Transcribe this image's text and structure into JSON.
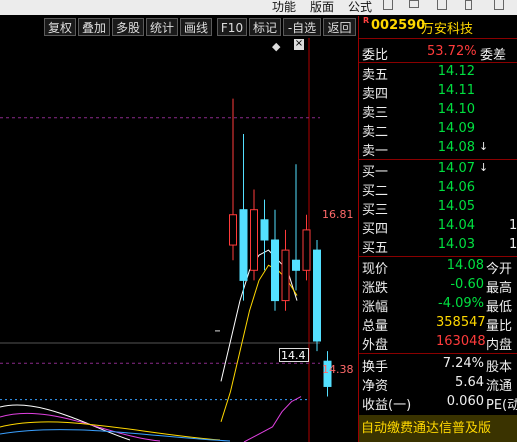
{
  "menu": {
    "items": [
      "功能",
      "版面",
      "公式"
    ]
  },
  "toolbar": {
    "buttons": [
      "复权",
      "叠加",
      "多股",
      "统计",
      "画线",
      "F10",
      "标记",
      "-自选",
      "返回"
    ]
  },
  "chart": {
    "price_labels": {
      "high": "16.81",
      "low": "14.38",
      "current": "14.4"
    },
    "close_icon": "×",
    "diamond_icon": "◆"
  },
  "chart_data": {
    "type": "candlestick",
    "title": "",
    "xlabel": "",
    "ylabel": "",
    "ylim": [
      13.6,
      17.6
    ],
    "reference_lines": [
      16.81,
      14.38
    ],
    "candles": [
      {
        "o": 15.55,
        "c": 15.85,
        "h": 17.0,
        "l": 15.4
      },
      {
        "o": 15.9,
        "c": 15.2,
        "h": 16.65,
        "l": 15.0
      },
      {
        "o": 15.3,
        "c": 15.9,
        "h": 16.1,
        "l": 15.2
      },
      {
        "o": 15.8,
        "c": 15.6,
        "h": 16.0,
        "l": 15.3
      },
      {
        "o": 15.6,
        "c": 15.0,
        "h": 15.9,
        "l": 14.9
      },
      {
        "o": 15.0,
        "c": 15.5,
        "h": 15.7,
        "l": 14.9
      },
      {
        "o": 15.4,
        "c": 15.3,
        "h": 16.35,
        "l": 15.1
      },
      {
        "o": 15.3,
        "c": 15.7,
        "h": 15.85,
        "l": 15.2
      },
      {
        "o": 15.5,
        "c": 14.6,
        "h": 15.6,
        "l": 14.5
      },
      {
        "o": 14.4,
        "c": 14.15,
        "h": 14.5,
        "l": 14.05
      }
    ],
    "ma_lines": [
      {
        "color": "#ffffff",
        "values": [
          14.2,
          14.6,
          15.0,
          15.3,
          15.45,
          15.5,
          15.4,
          15.3,
          15.0
        ]
      },
      {
        "color": "#ffd800",
        "values": [
          13.8,
          14.1,
          14.5,
          14.9,
          15.2,
          15.35,
          15.3,
          15.2,
          15.05
        ]
      },
      {
        "color": "#e040e0",
        "values": [
          13.6,
          13.65,
          13.7,
          13.75,
          13.9,
          14.0,
          14.05
        ]
      }
    ]
  },
  "stock": {
    "flag": "R",
    "code": "002590",
    "name": "万安科技"
  },
  "ratio": {
    "label": "委比",
    "value": "53.72%",
    "label2": "委差"
  },
  "asks": [
    {
      "label": "卖五",
      "price": "14.12"
    },
    {
      "label": "卖四",
      "price": "14.11"
    },
    {
      "label": "卖三",
      "price": "14.10"
    },
    {
      "label": "卖二",
      "price": "14.09"
    },
    {
      "label": "卖一",
      "price": "14.08",
      "arrow": "↓"
    }
  ],
  "bids": [
    {
      "label": "买一",
      "price": "14.07",
      "arrow": "↓",
      "vol": ""
    },
    {
      "label": "买二",
      "price": "14.06",
      "vol": ""
    },
    {
      "label": "买三",
      "price": "14.05",
      "vol": ""
    },
    {
      "label": "买四",
      "price": "14.04",
      "vol": "1"
    },
    {
      "label": "买五",
      "price": "14.03",
      "vol": "1"
    }
  ],
  "quote": [
    {
      "label": "现价",
      "value": "14.08",
      "label2": "今开",
      "color": "green"
    },
    {
      "label": "涨跌",
      "value": "-0.60",
      "label2": "最高",
      "color": "green"
    },
    {
      "label": "涨幅",
      "value": "-4.09%",
      "label2": "最低",
      "color": "green"
    },
    {
      "label": "总量",
      "value": "358547",
      "label2": "量比",
      "color": "yellow"
    },
    {
      "label": "外盘",
      "value": "163048",
      "label2": "内盘",
      "color": "red"
    }
  ],
  "finance": [
    {
      "label": "换手",
      "value": "7.24%",
      "label2": "股本"
    },
    {
      "label": "净资",
      "value": "5.64",
      "label2": "流通"
    },
    {
      "label": "收益(一)",
      "value": "0.060",
      "label2": "PE(动"
    }
  ],
  "promo": "自动缴费通达信普及版"
}
